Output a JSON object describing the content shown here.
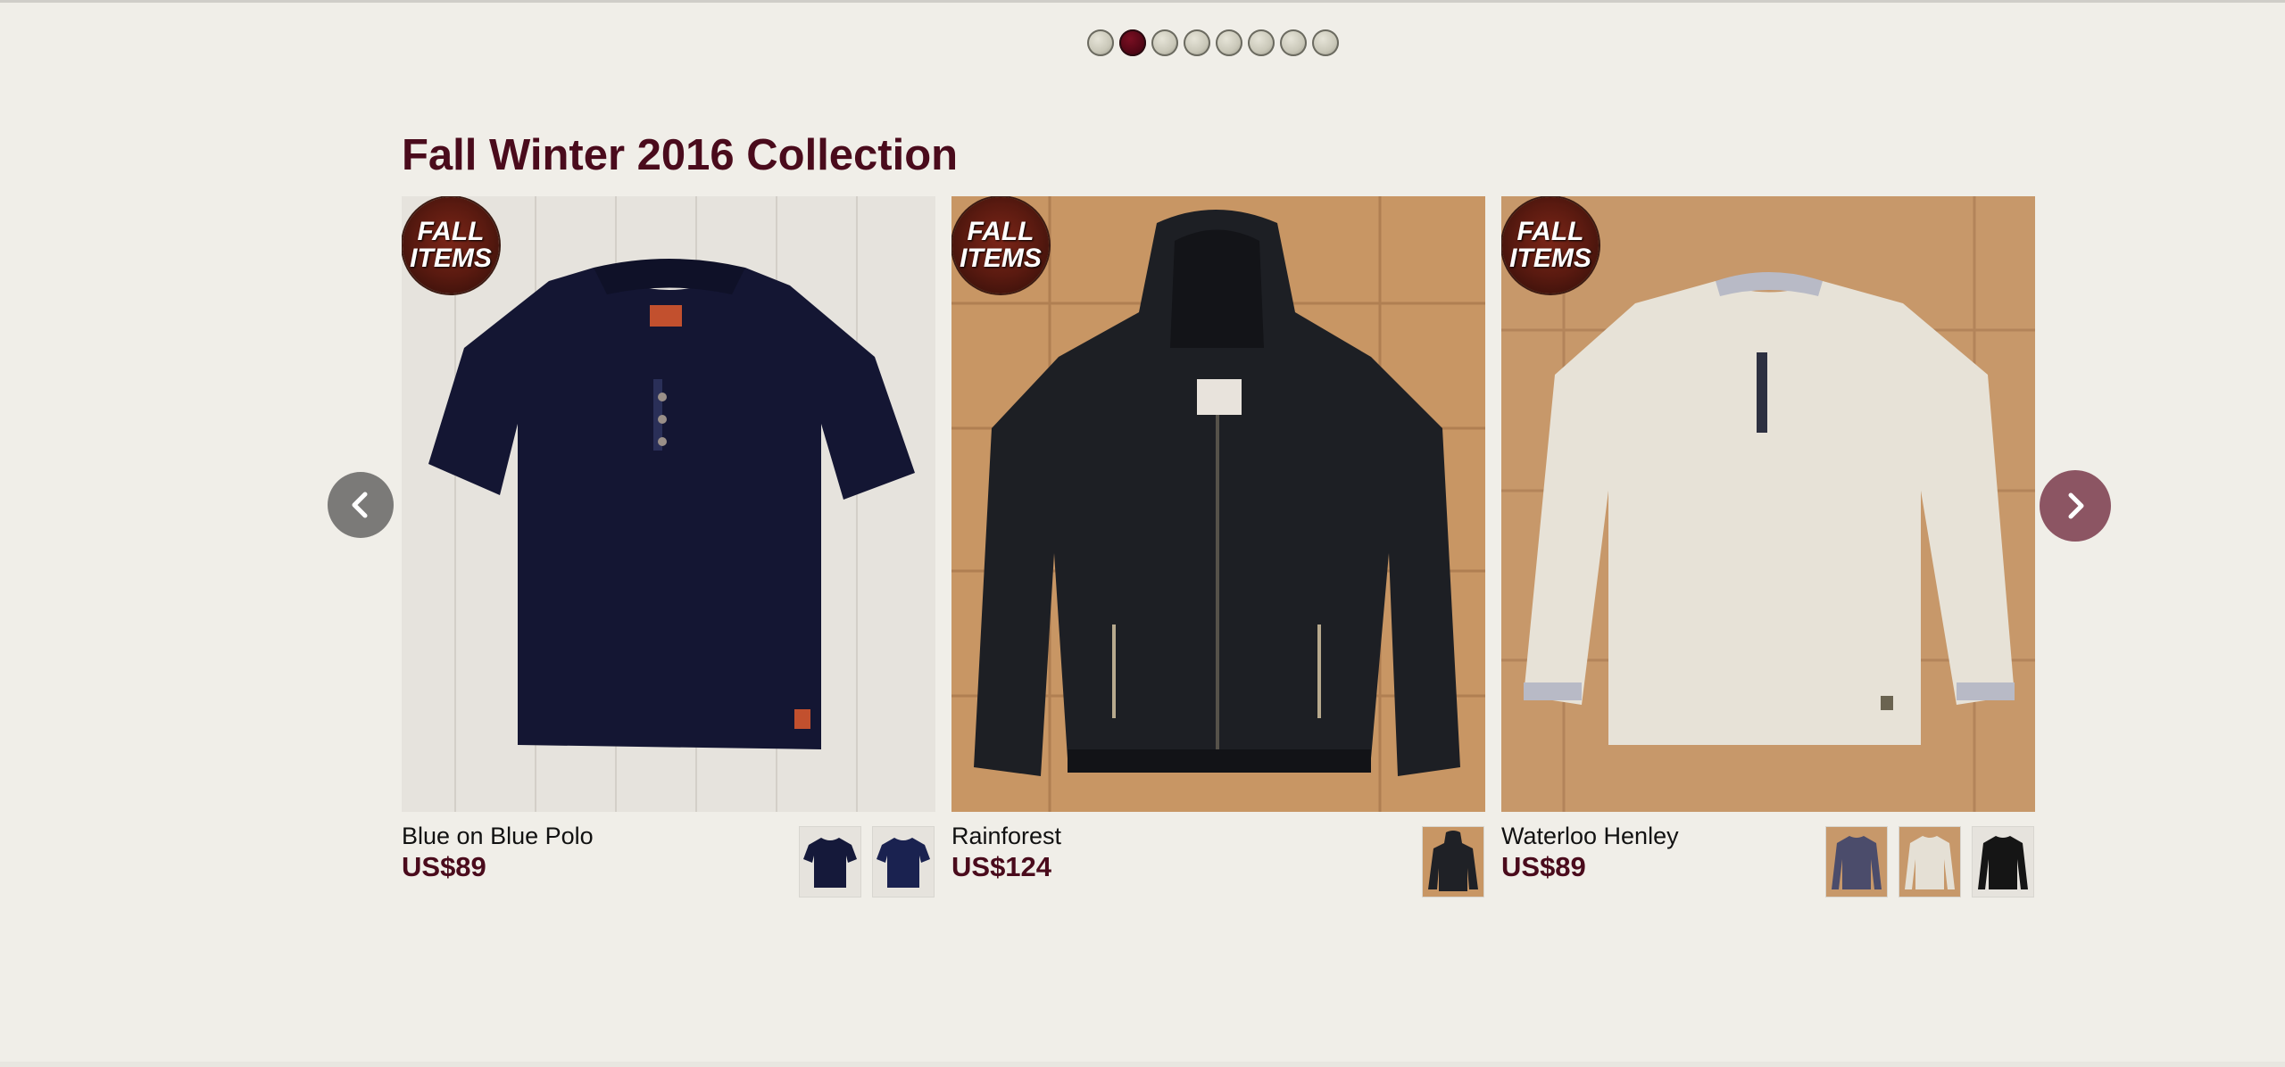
{
  "carousel": {
    "dot_count": 8,
    "active_dot_index": 1
  },
  "collection": {
    "title": "Fall Winter 2016 Collection"
  },
  "badge": {
    "line1": "FALL",
    "line2": "ITEMS"
  },
  "products": [
    {
      "name": "Blue on Blue Polo",
      "price": "US$89",
      "garment": "polo-shirt",
      "color": "#141633",
      "thumb_colors": [
        "#15193a",
        "#1a2250"
      ]
    },
    {
      "name": "Rainforest",
      "price": "US$124",
      "garment": "hooded-jacket",
      "color": "#1d1f24",
      "thumb_colors": [
        "#1f2126"
      ]
    },
    {
      "name": "Waterloo Henley",
      "price": "US$89",
      "garment": "henley-shirt",
      "color": "#e7e2d7",
      "thumb_colors": [
        "#4b4c6b",
        "#e5e0d5",
        "#151515"
      ]
    }
  ],
  "colors": {
    "accent": "#4a0b1c",
    "background": "#f0eee8"
  }
}
